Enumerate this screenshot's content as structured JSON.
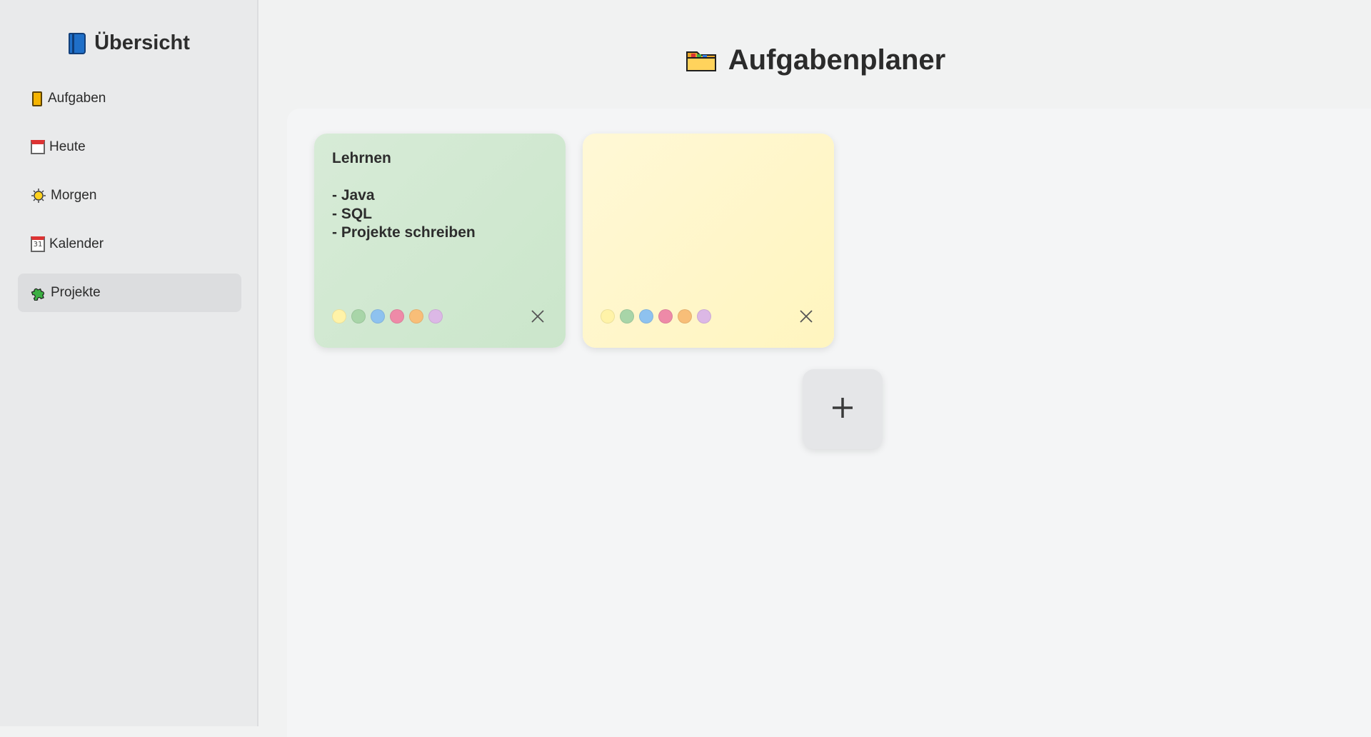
{
  "sidebar": {
    "title": "Übersicht",
    "title_icon": "book-icon",
    "items": [
      {
        "label": "Aufgaben",
        "icon": "notebook-icon",
        "active": false
      },
      {
        "label": "Heute",
        "icon": "calendar-page-icon",
        "active": false
      },
      {
        "label": "Morgen",
        "icon": "sun-icon",
        "active": false
      },
      {
        "label": "Kalender",
        "icon": "calendar-icon",
        "icon_text": "31",
        "active": false
      },
      {
        "label": "Projekte",
        "icon": "puzzle-icon",
        "active": true
      }
    ]
  },
  "header": {
    "title": "Aufgabenplaner",
    "icon": "folder-icon"
  },
  "notes": [
    {
      "text": "Lehrnen\n\n- Java\n- SQL\n- Projekte schreiben",
      "color": "#d3ead3"
    },
    {
      "text": "",
      "color": "#fff6c8"
    }
  ],
  "palette": [
    "#fff3a8",
    "#a8d5a8",
    "#8ec2ef",
    "#ee8aa8",
    "#f8be78",
    "#dcb8e6"
  ],
  "add_button": {
    "label": "+"
  },
  "colors": {
    "sidebar_bg": "#e9eaeb",
    "active_bg": "#dcdddf",
    "page_bg": "#f1f2f2"
  }
}
